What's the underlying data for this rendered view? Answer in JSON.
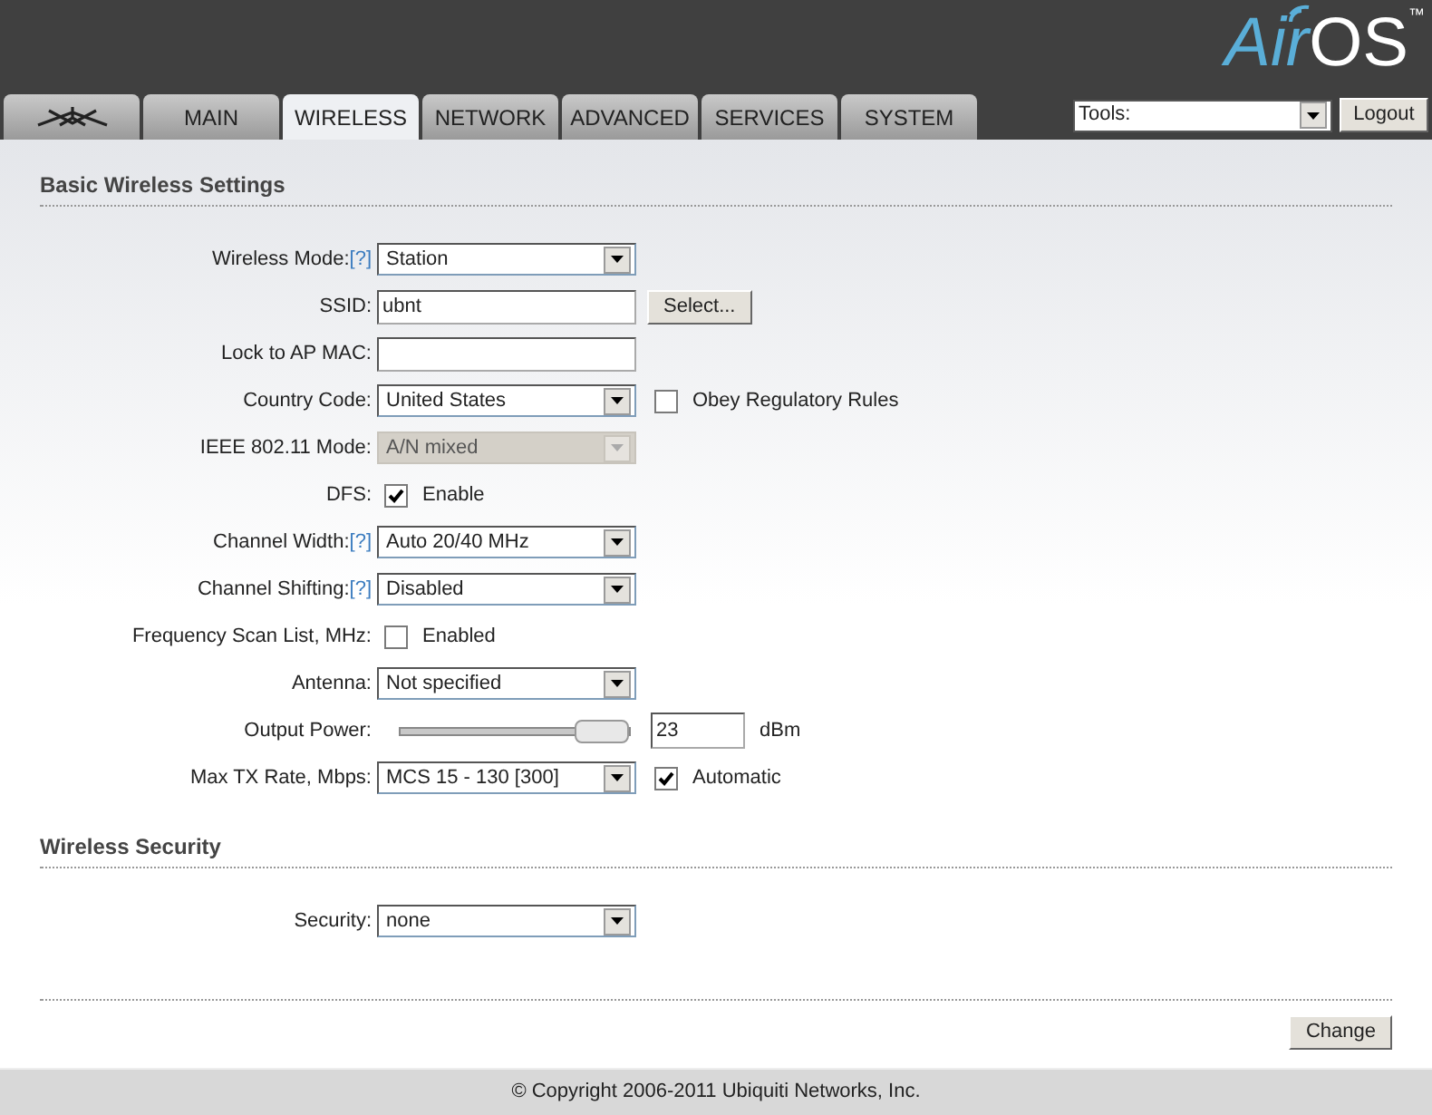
{
  "logo": {
    "first": "Air",
    "second": "OS",
    "mark": "™"
  },
  "tabs": [
    {
      "kind": "logo",
      "selected": false
    },
    {
      "kind": "text",
      "label": "MAIN",
      "selected": false
    },
    {
      "kind": "text",
      "label": "WIRELESS",
      "selected": true
    },
    {
      "kind": "text",
      "label": "NETWORK",
      "selected": false
    },
    {
      "kind": "text",
      "label": "ADVANCED",
      "selected": false
    },
    {
      "kind": "text",
      "label": "SERVICES",
      "selected": false
    },
    {
      "kind": "text",
      "label": "SYSTEM",
      "selected": false
    }
  ],
  "tools": {
    "value": "Tools:"
  },
  "logout_button": "Logout",
  "sections": [
    {
      "title": "Basic Wireless Settings",
      "rows": [
        {
          "label": "Wireless Mode:",
          "help": "[?]",
          "kind": "select",
          "value": "Station",
          "disabled": false
        },
        {
          "label": "SSID:",
          "kind": "text",
          "value": "ubnt",
          "button": "Select..."
        },
        {
          "label": "Lock to AP MAC:",
          "kind": "text"
        },
        {
          "label": "Country Code:",
          "kind": "select",
          "value": "United States",
          "disabled": false,
          "side_checkbox": {
            "label": "Obey Regulatory Rules",
            "checked": false
          }
        },
        {
          "label": "IEEE 802.11 Mode:",
          "kind": "select",
          "value": "A/N mixed",
          "disabled": true
        },
        {
          "label": "DFS:",
          "kind": "checkbox",
          "checkbox_label": "Enable",
          "checked": true
        },
        {
          "label": "Channel Width:",
          "help": "[?]",
          "kind": "select",
          "value": "Auto 20/40 MHz",
          "disabled": false
        },
        {
          "label": "Channel Shifting:",
          "help": "[?]",
          "kind": "select",
          "value": "Disabled",
          "disabled": false
        },
        {
          "label": "Frequency Scan List, MHz:",
          "kind": "checkbox",
          "checkbox_label": "Enabled",
          "checked": false
        },
        {
          "label": "Antenna:",
          "kind": "select",
          "value": "Not specified",
          "disabled": false
        },
        {
          "label": "Output Power:",
          "kind": "slider",
          "level": 1,
          "value": "23",
          "unit": "dBm"
        },
        {
          "label": "Max TX Rate, Mbps:",
          "kind": "select",
          "value": "MCS 15 - 130 [300]",
          "disabled": false,
          "side_checkbox": {
            "label": "Automatic",
            "checked": true
          }
        }
      ]
    },
    {
      "title": "Wireless Security",
      "rows": [
        {
          "label": "Security:",
          "kind": "select",
          "value": "none",
          "disabled": false
        }
      ]
    }
  ],
  "change_button": "Change",
  "footer": "© Copyright 2006-2011 Ubiquiti Networks, Inc."
}
